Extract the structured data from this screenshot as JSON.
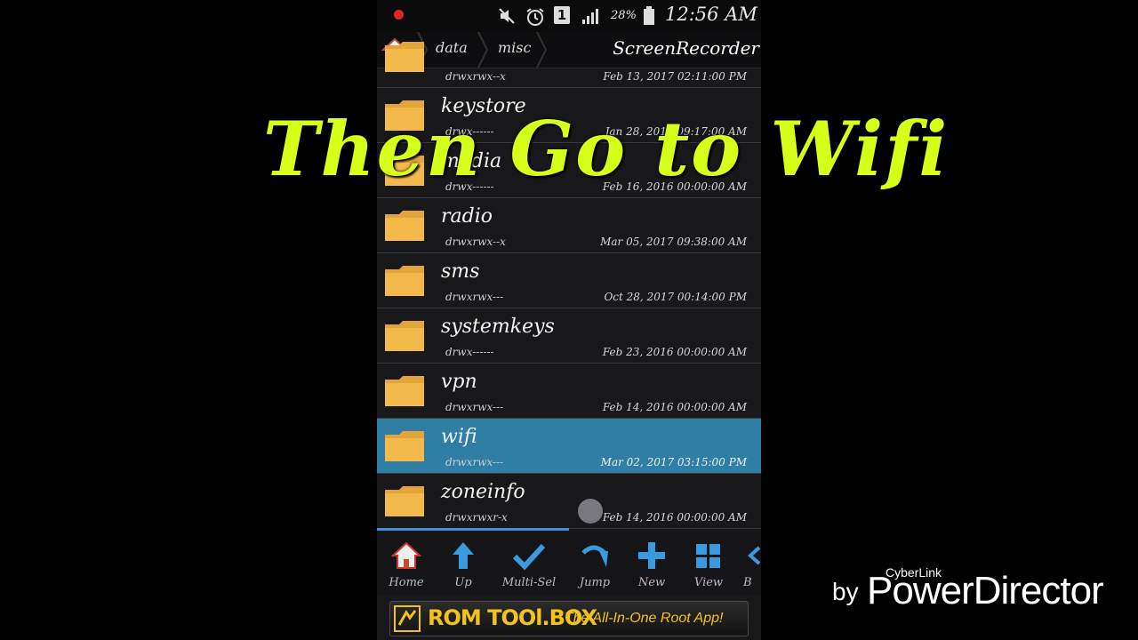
{
  "status_bar": {
    "battery": "28%",
    "time": "12:56 AM",
    "sim_label": "1",
    "icons": [
      "record-dot-icon",
      "mute-icon",
      "alarm-icon",
      "sim-icon",
      "signal-icon",
      "battery-icon"
    ]
  },
  "breadcrumb": {
    "items": [
      "data",
      "misc"
    ],
    "current": "ScreenRecorder"
  },
  "files": [
    {
      "name": "",
      "perm": "drwxrwx--x",
      "date": "Feb 13, 2017 02:11:00 PM"
    },
    {
      "name": "keystore",
      "perm": "drwx------",
      "date": "Jan 28, 2017 09:17:00 AM"
    },
    {
      "name": "media",
      "perm": "drwx------",
      "date": "Feb 16, 2016 00:00:00 AM"
    },
    {
      "name": "radio",
      "perm": "drwxrwx--x",
      "date": "Mar 05, 2017 09:38:00 AM"
    },
    {
      "name": "sms",
      "perm": "drwxrwx---",
      "date": "Oct 28, 2017 00:14:00 PM"
    },
    {
      "name": "systemkeys",
      "perm": "drwx------",
      "date": "Feb 23, 2016 00:00:00 AM"
    },
    {
      "name": "vpn",
      "perm": "drwxrwx---",
      "date": "Feb 14, 2016 00:00:00 AM"
    },
    {
      "name": "wifi",
      "perm": "drwxrwx---",
      "date": "Mar 02, 2017 03:15:00 PM",
      "selected": true
    },
    {
      "name": "zoneinfo",
      "perm": "drwxrwxr-x",
      "date": "Feb 14, 2016 00:00:00 AM"
    }
  ],
  "toolbar": {
    "home": "Home",
    "up": "Up",
    "multisel": "Multi-Sel",
    "jump": "Jump",
    "new": "New",
    "view": "View",
    "more": "B"
  },
  "ad": {
    "brand": "ROM TOOl.BOX",
    "tagline": "The All-In-One Root App!"
  },
  "overlay_caption": "Then Go to Wifi",
  "watermark": {
    "by": "by",
    "small": "CyberLink",
    "main": "PowerDirector"
  },
  "colors": {
    "selected_row": "#2f7ea3",
    "caption": "#d6ff1a",
    "folder": "#f3b94a",
    "ad_text": "#f2c21e"
  }
}
